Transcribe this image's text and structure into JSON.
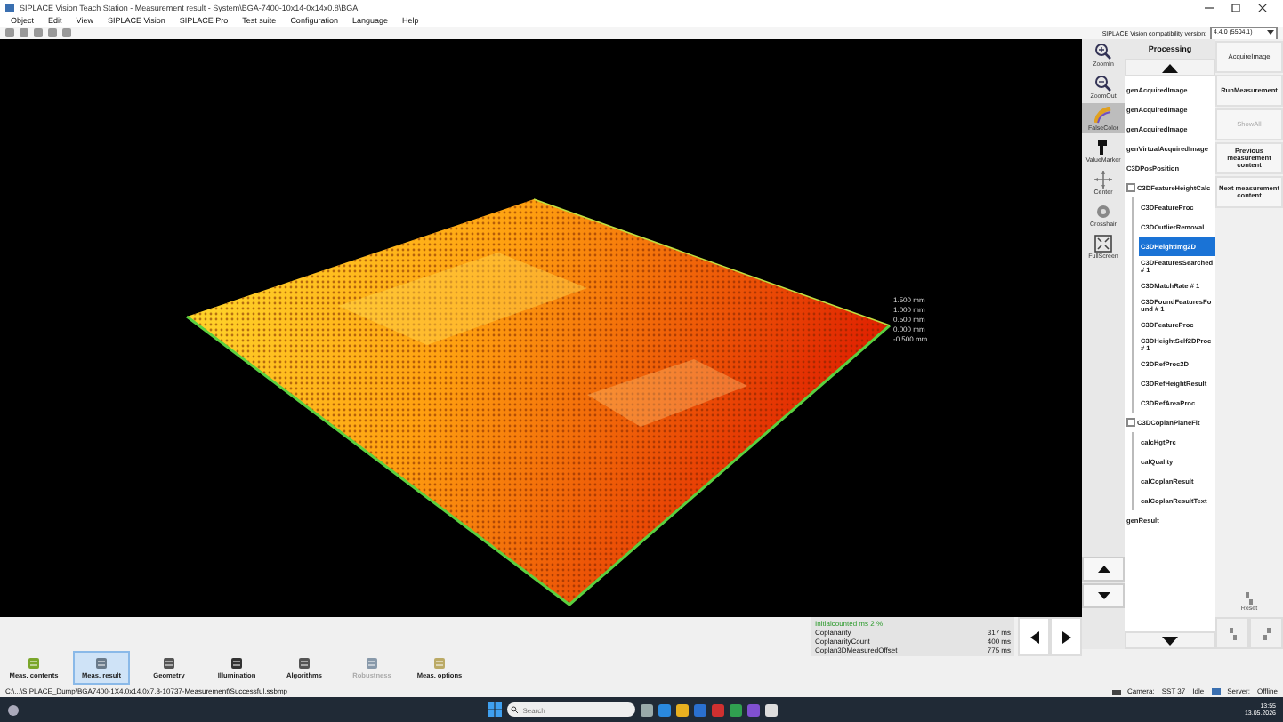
{
  "window": {
    "title": "SIPLACE Vision Teach Station - Measurement result - System\\BGA-7400-10x14-0x14x0.8\\BGA"
  },
  "menu": [
    "Object",
    "Edit",
    "View",
    "SIPLACE Vision",
    "SIPLACE Pro",
    "Test suite",
    "Configuration",
    "Language",
    "Help"
  ],
  "compatibility": {
    "label": "SIPLACE Vision compatibility version:",
    "value": "4.4.0 (5504.1)"
  },
  "viewport": {
    "scale_labels": [
      "1.500 mm",
      "1.000 mm",
      "0.500 mm",
      "0.000 mm",
      "-0.500 mm"
    ]
  },
  "view_tools": [
    {
      "label": "ZoomIn",
      "selected": false
    },
    {
      "label": "ZoomOut",
      "selected": false
    },
    {
      "label": "FalseColor",
      "selected": true
    },
    {
      "label": "ValueMarker",
      "selected": false
    },
    {
      "label": "Center",
      "selected": false
    },
    {
      "label": "Crosshair",
      "selected": false
    },
    {
      "label": "FullScreen",
      "selected": false
    }
  ],
  "processing": {
    "title": "Processing",
    "tree": [
      {
        "label": "genAcquiredImage",
        "selected": false
      },
      {
        "label": "genAcquiredImage",
        "selected": false
      },
      {
        "label": "genAcquiredImage",
        "selected": false
      },
      {
        "label": "genVirtualAcquiredImage",
        "selected": false
      },
      {
        "label": "C3DPosPosition",
        "selected": false
      },
      {
        "label": "C3DFeatureHeightCalc",
        "selected": false,
        "expanded": true,
        "children": [
          {
            "label": "C3DFeatureProc",
            "selected": false
          },
          {
            "label": "C3DOutlierRemoval",
            "selected": false
          },
          {
            "label": "C3DHeightImg2D",
            "selected": true
          },
          {
            "label": "C3DFeaturesSearched # 1",
            "selected": false
          },
          {
            "label": "C3DMatchRate # 1",
            "selected": false
          },
          {
            "label": "C3DFoundFeaturesFound # 1",
            "selected": false
          },
          {
            "label": "C3DFeatureProc",
            "selected": false
          },
          {
            "label": "C3DHeightSelf2DProc # 1",
            "selected": false
          },
          {
            "label": "C3DRefProc2D",
            "selected": false
          },
          {
            "label": "C3DRefHeightResult",
            "selected": false
          },
          {
            "label": "C3DRefAreaProc",
            "selected": false
          }
        ]
      },
      {
        "label": "C3DCoplanPlaneFit",
        "selected": false,
        "expanded": true,
        "children": [
          {
            "label": "calcHgtPrc",
            "selected": false
          },
          {
            "label": "calQuality",
            "selected": false
          },
          {
            "label": "calCoplanResult",
            "selected": false
          },
          {
            "label": "calCoplanResultText",
            "selected": false
          }
        ]
      },
      {
        "label": "genResult",
        "selected": false
      }
    ]
  },
  "actions": [
    {
      "label": "AcquireImage",
      "disabled": false,
      "bold": false
    },
    {
      "label": "RunMeasurement",
      "disabled": false,
      "bold": true
    },
    {
      "label": "ShowAll",
      "disabled": true,
      "bold": false
    },
    {
      "label": "Previous measurement content",
      "disabled": false,
      "bold": true
    },
    {
      "label": "Next measurement content",
      "disabled": false,
      "bold": true
    }
  ],
  "reset": {
    "label": "Reset"
  },
  "results": {
    "status": "Initialcounted ms 2 %",
    "rows": [
      {
        "name": "Coplanarity",
        "value": "317 ms"
      },
      {
        "name": "CoplanarityCount",
        "value": "400 ms"
      },
      {
        "name": "Coplan3DMeasuredOffset",
        "value": "775 ms"
      }
    ]
  },
  "bottom_tabs": [
    {
      "label": "Meas. contents",
      "selected": false,
      "disabled": false
    },
    {
      "label": "Meas. result",
      "selected": true,
      "disabled": false
    },
    {
      "label": "Geometry",
      "selected": false,
      "disabled": false
    },
    {
      "label": "Illumination",
      "selected": false,
      "disabled": false
    },
    {
      "label": "Algorithms",
      "selected": false,
      "disabled": false
    },
    {
      "label": "Robustness",
      "selected": false,
      "disabled": true
    },
    {
      "label": "Meas. options",
      "selected": false,
      "disabled": false
    }
  ],
  "status_bar": {
    "path": "C:\\...\\SIPLACE_Dump\\BGA7400-1X4.0x14.0x7.8-10737-Measurement\\Successful.ssbmp",
    "camera_label": "Camera:",
    "camera_value": "SST 37",
    "camera_state": "Idle",
    "server_label": "Server:",
    "server_state": "Offline"
  },
  "taskbar": {
    "search_placeholder": "Search",
    "time": "13:55",
    "date": "13.05.2026"
  }
}
